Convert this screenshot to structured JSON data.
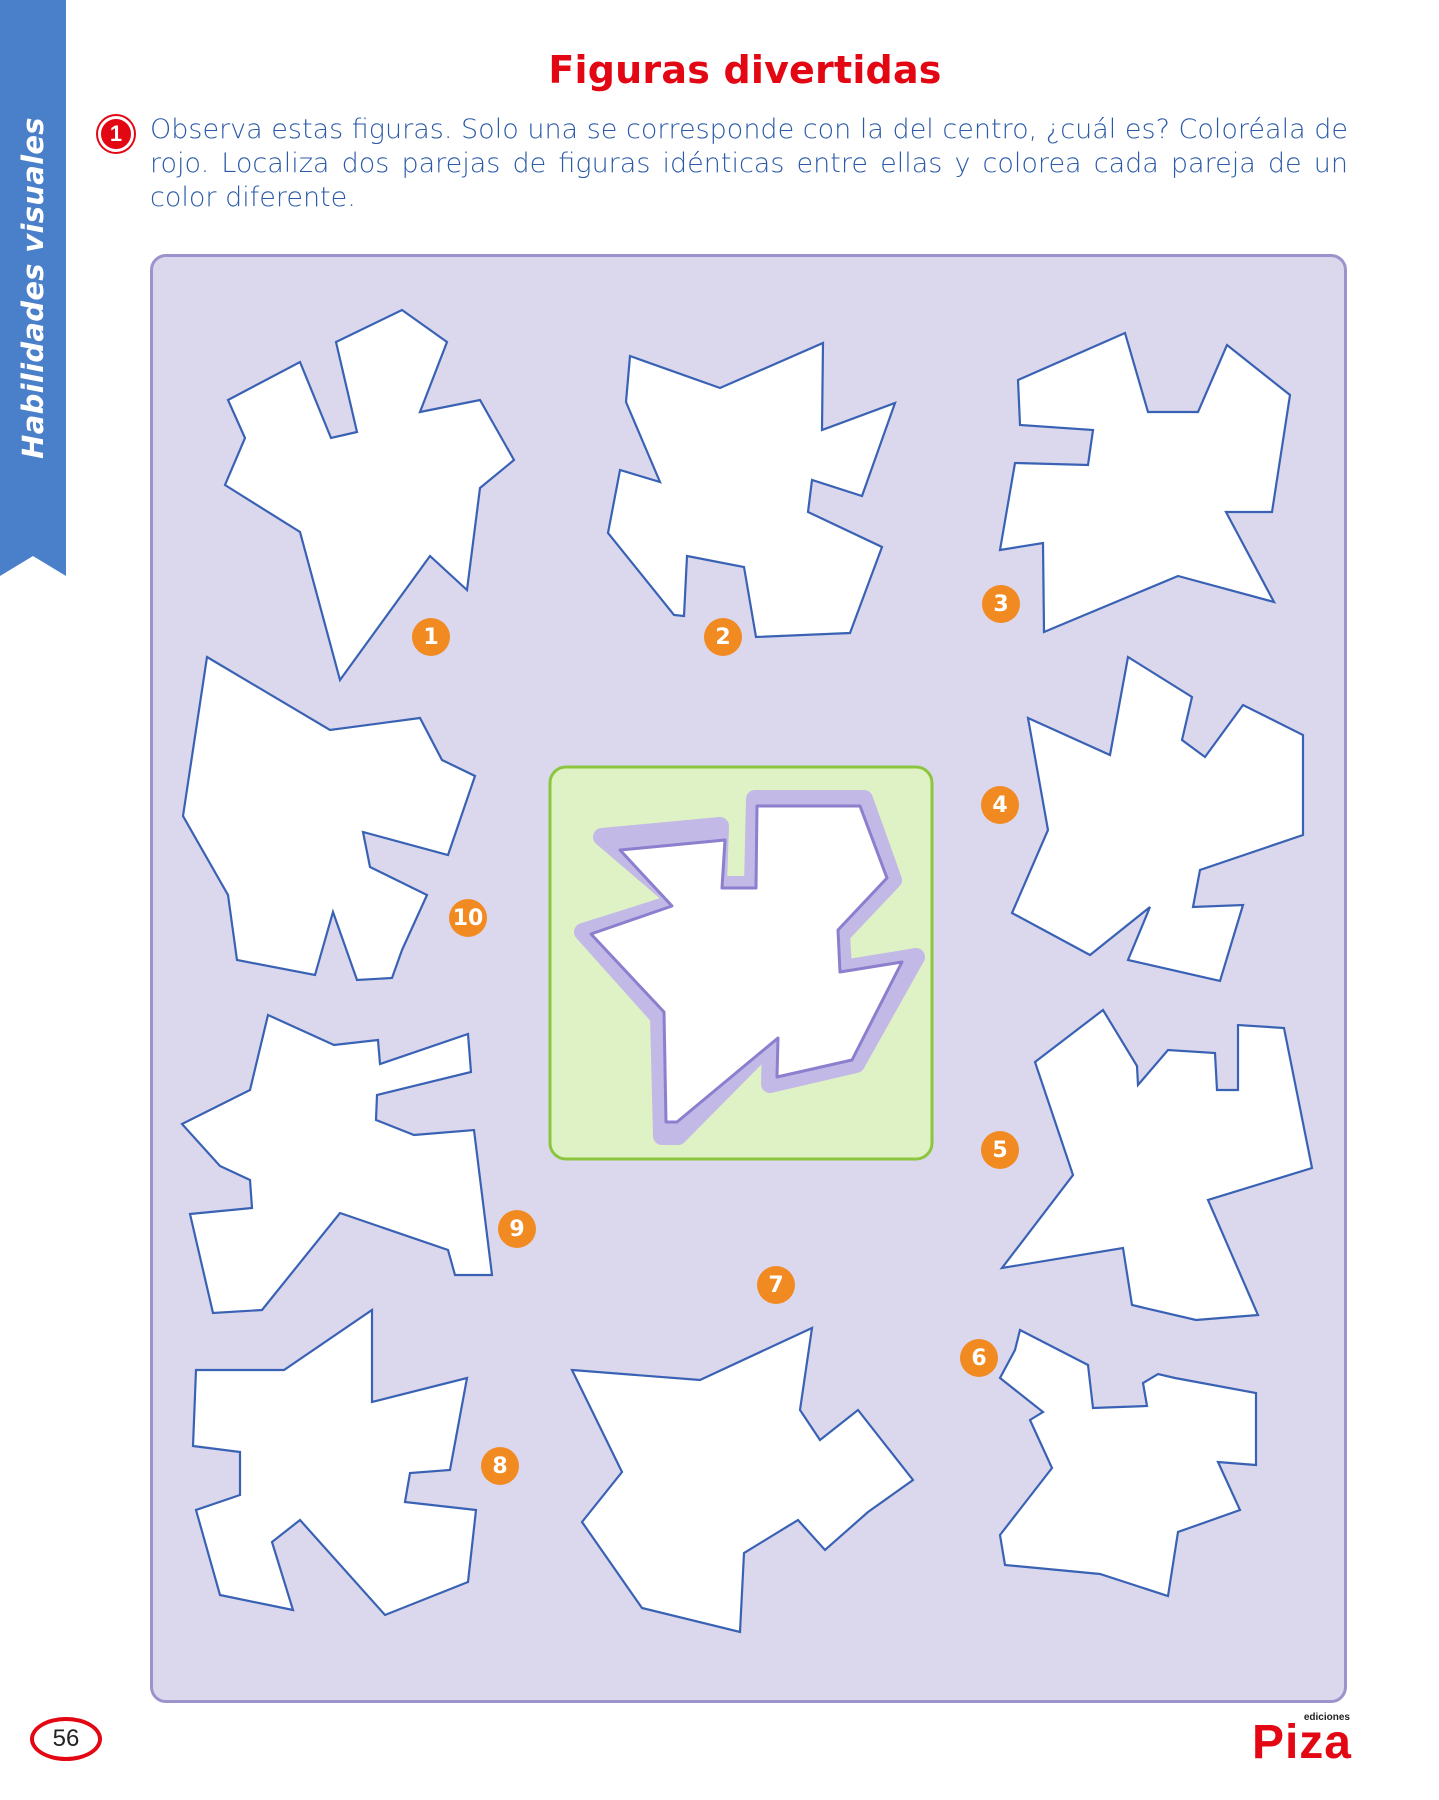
{
  "side_tab": {
    "label": "Habilidades visuales",
    "color": "#4a7fc9"
  },
  "header": {
    "title": "Figuras divertidas"
  },
  "exercise": {
    "number": "1",
    "instructions": "Observa estas figuras. Solo una se corresponde con la del centro, ¿cuál es? Coloréala de rojo. Localiza dos parejas de figuras idénticas entre ellas y colorea cada pareja de un color diferente."
  },
  "figures": [
    {
      "number": "1",
      "icon": "irregular-polygon-icon"
    },
    {
      "number": "2",
      "icon": "irregular-polygon-icon"
    },
    {
      "number": "3",
      "icon": "irregular-polygon-icon"
    },
    {
      "number": "4",
      "icon": "irregular-polygon-icon"
    },
    {
      "number": "5",
      "icon": "irregular-polygon-icon"
    },
    {
      "number": "6",
      "icon": "irregular-polygon-icon"
    },
    {
      "number": "7",
      "icon": "irregular-polygon-icon"
    },
    {
      "number": "8",
      "icon": "irregular-polygon-icon"
    },
    {
      "number": "9",
      "icon": "irregular-polygon-icon"
    },
    {
      "number": "10",
      "icon": "irregular-polygon-icon"
    }
  ],
  "footer": {
    "page_number": "56",
    "logo_small": "ediciones",
    "logo_main": "Piza"
  },
  "colors": {
    "title": "#e30613",
    "instructions": "#2b5aa8",
    "board_bg": "#dbd8ee",
    "board_border": "#9d93cc",
    "center_bg": "#dff2c6",
    "center_border": "#8cc63f",
    "badge": "#f18a21",
    "shape_stroke": "#3a62b4"
  }
}
